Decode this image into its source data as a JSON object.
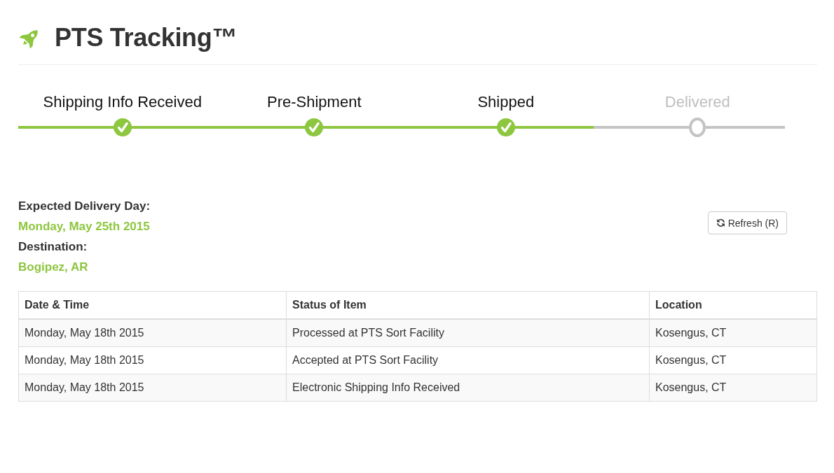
{
  "header": {
    "title": "PTS Tracking™"
  },
  "progress": {
    "level": 0.75,
    "steps": [
      {
        "label": "Shipping Info Received",
        "done": true
      },
      {
        "label": "Pre-Shipment",
        "done": true
      },
      {
        "label": "Shipped",
        "done": true
      },
      {
        "label": "Delivered",
        "done": false
      }
    ]
  },
  "delivery_info": [
    {
      "label": "Expected Delivery Day:",
      "value": "Monday, May 25th 2015"
    },
    {
      "label": "Destination:",
      "value": "Bogipez, AR"
    }
  ],
  "refresh_button": {
    "label": "Refresh (R)"
  },
  "table": {
    "columns": [
      "Date & Time",
      "Status of Item",
      "Location"
    ],
    "rows": [
      [
        "Monday, May 18th 2015",
        "Processed at PTS Sort Facility",
        "Kosengus, CT"
      ],
      [
        "Monday, May 18th 2015",
        "Accepted at PTS Sort Facility",
        "Kosengus, CT"
      ],
      [
        "Monday, May 18th 2015",
        "Electronic Shipping Info Received",
        "Kosengus, CT"
      ]
    ]
  }
}
